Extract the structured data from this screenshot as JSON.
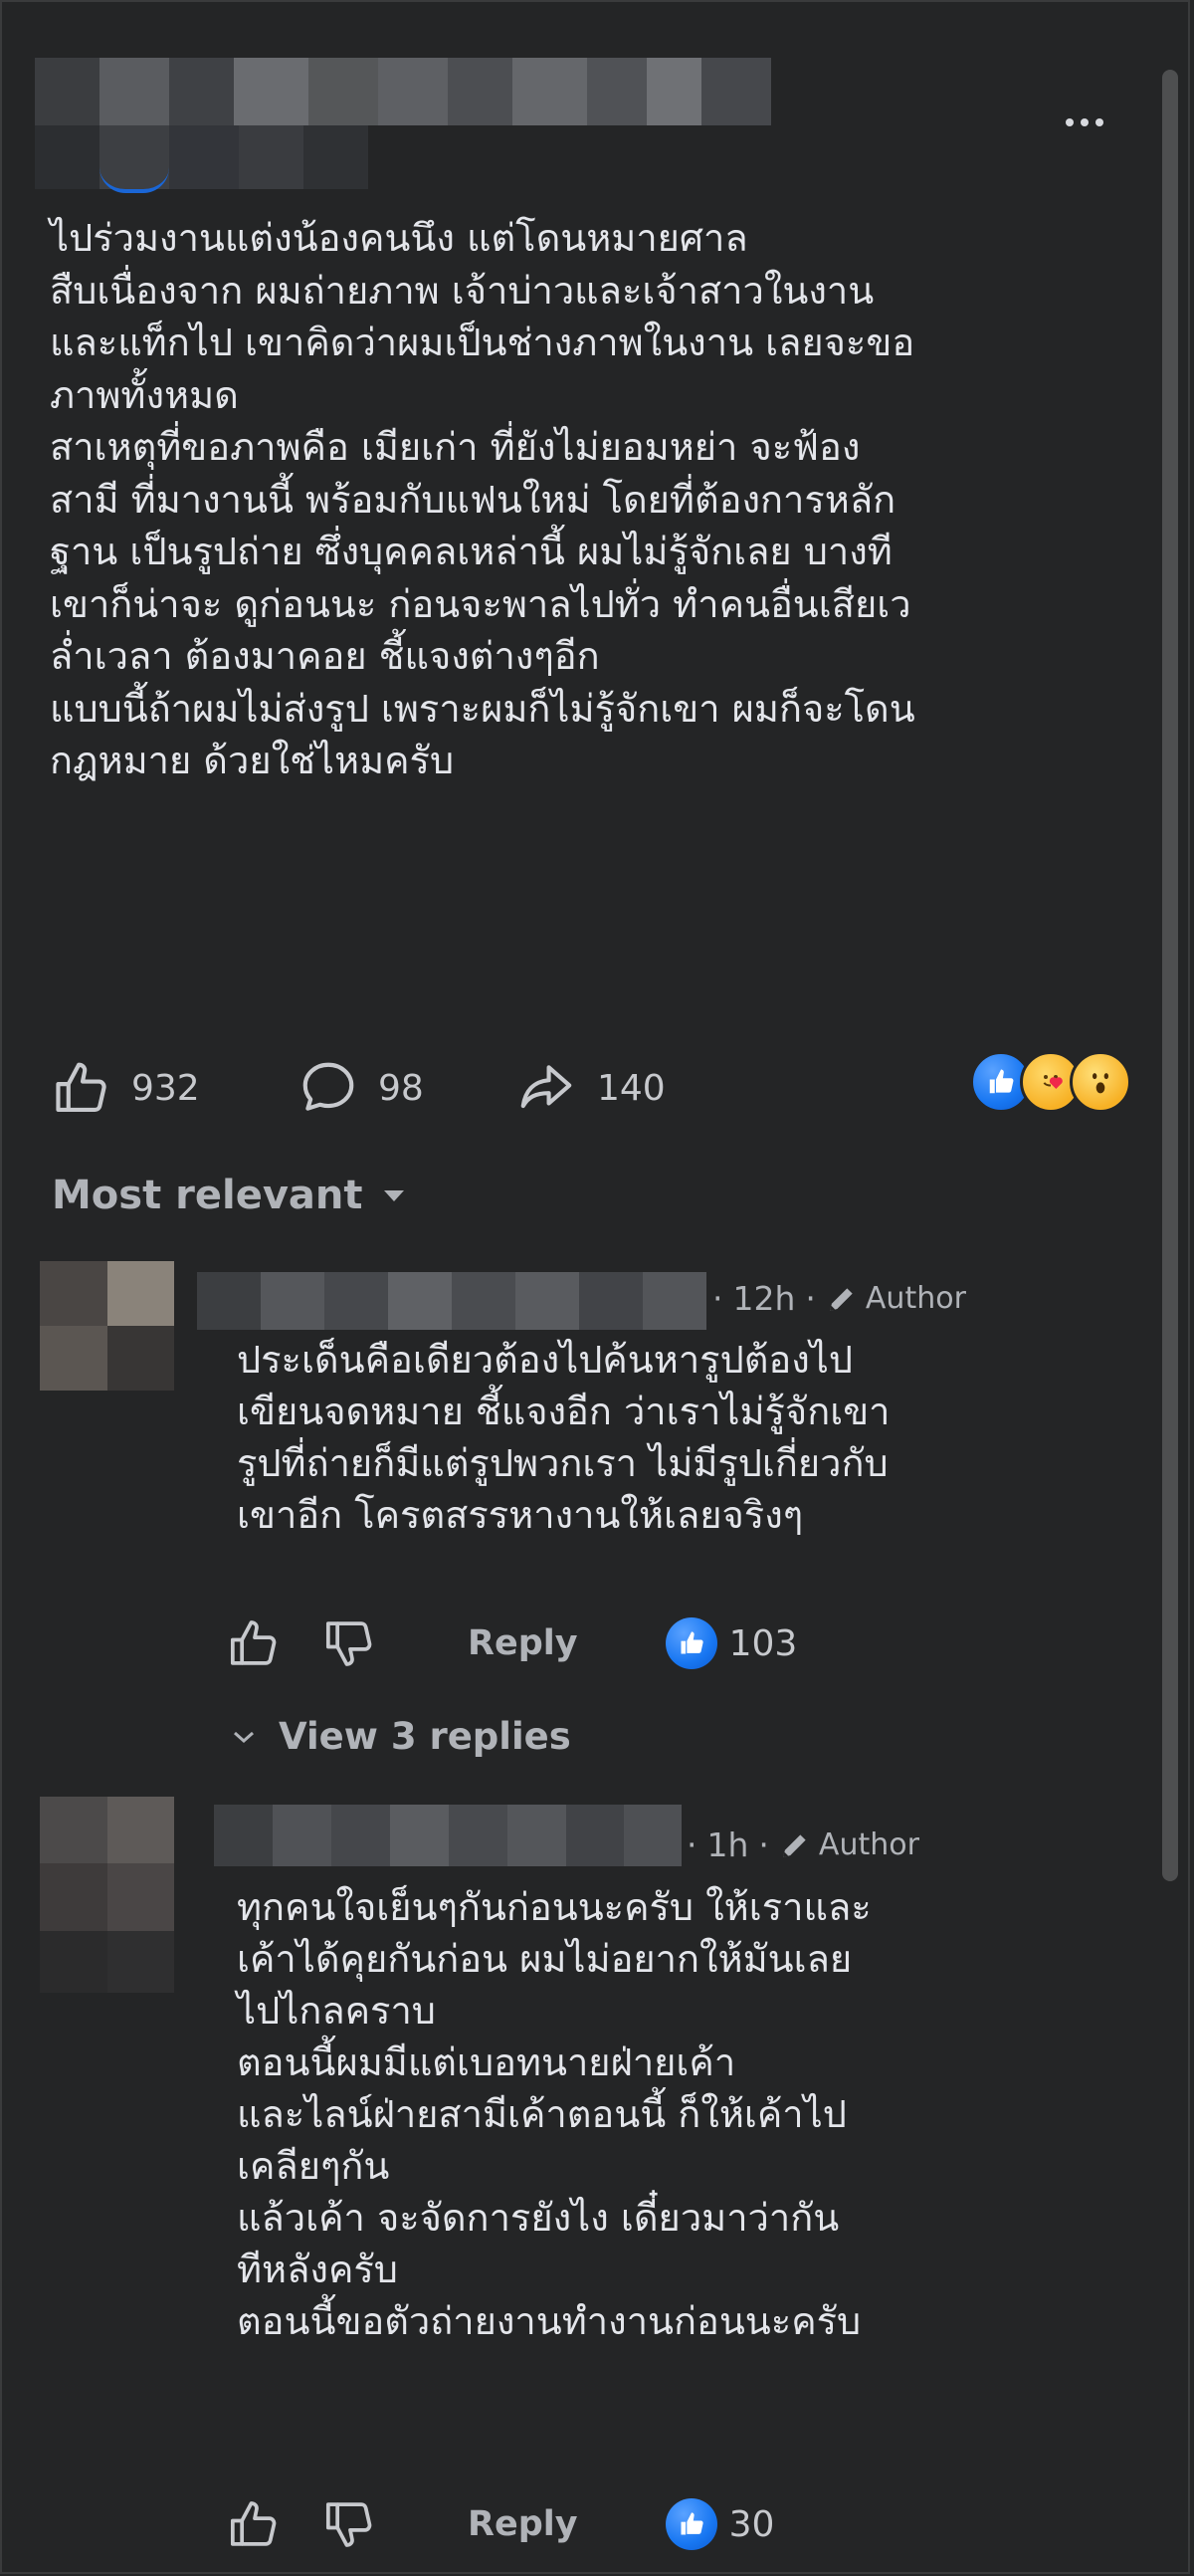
{
  "post": {
    "text": "ไปร่วมงานแต่งน้องคนนึง แต่โดนหมายศาล\nสืบเนื่องจาก ผมถ่ายภาพ เจ้าบ่าวและเจ้าสาวในงาน\nและแท็กไป เขาคิดว่าผมเป็นช่างภาพในงาน เลยจะขอ\nภาพทั้งหมด\nสาเหตุที่ขอภาพคือ เมียเก่า ที่ยังไม่ยอมหย่า จะฟ้อง\nสามี ที่มางานนี้ พร้อมกับแฟนใหม่ โดยที่ต้องการหลัก\nฐาน เป็นรูปถ่าย ซึ่งบุคคลเหล่านี้ ผมไม่รู้จักเลย บางที\nเขาก็น่าจะ ดูก่อนนะ ก่อนจะพาลไปทั่ว ทำคนอื่นเสียเว\nล่ำเวลา ต้องมาคอย ชี้แจงต่างๆอีก\nแบบนี้ถ้าผมไม่ส่งรูป เพราะผมก็ไม่รู้จักเขา ผมก็จะโดน\nกฎหมาย ด้วยใช่ไหมครับ",
    "likes": "932",
    "comments": "98",
    "shares": "140",
    "reaction_icons": [
      "like-icon",
      "care-icon",
      "wow-icon"
    ]
  },
  "sort": {
    "label": "Most relevant"
  },
  "comments": [
    {
      "time": "12h",
      "separator": "·",
      "author_badge": "Author",
      "text": "ประเด็นคือเดียวต้องไปค้นหารูปต้องไป\nเขียนจดหมาย ชี้แจงอีก ว่าเราไม่รู้จักเขา\nรูปที่ถ่ายก็มีแต่รูปพวกเรา ไม่มีรูปเกี่ยวกับ\nเขาอีก โครตสรรหางานให้เลยจริงๆ",
      "reply_label": "Reply",
      "like_count": "103",
      "view_replies": "View 3 replies"
    },
    {
      "time": "1h",
      "separator": "·",
      "author_badge": "Author",
      "text": "ทุกคนใจเย็นๆกันก่อนนะครับ ให้เราและ\nเค้าได้คุยกันก่อน ผมไม่อยากให้มันเลย\nไปไกลคราบ\nตอนนี้ผมมีแต่เบอทนายฝ่ายเค้า\nและไลน์ฝ่ายสามีเค้าตอนนี้ ก็ให้เค้าไป\nเคลียๆกัน\nแล้วเค้า จะจัดการยังไง เดี๋ยวมาว่ากัน\nทีหลังครับ\nตอนนี้ขอตัวถ่ายงานทำงานก่อนนะครับ",
      "reply_label": "Reply",
      "like_count": "30"
    }
  ],
  "colors": {
    "background": "#242526",
    "text": "#e4e6eb",
    "muted": "#b0b3b8",
    "like_blue": "#1877f2"
  }
}
